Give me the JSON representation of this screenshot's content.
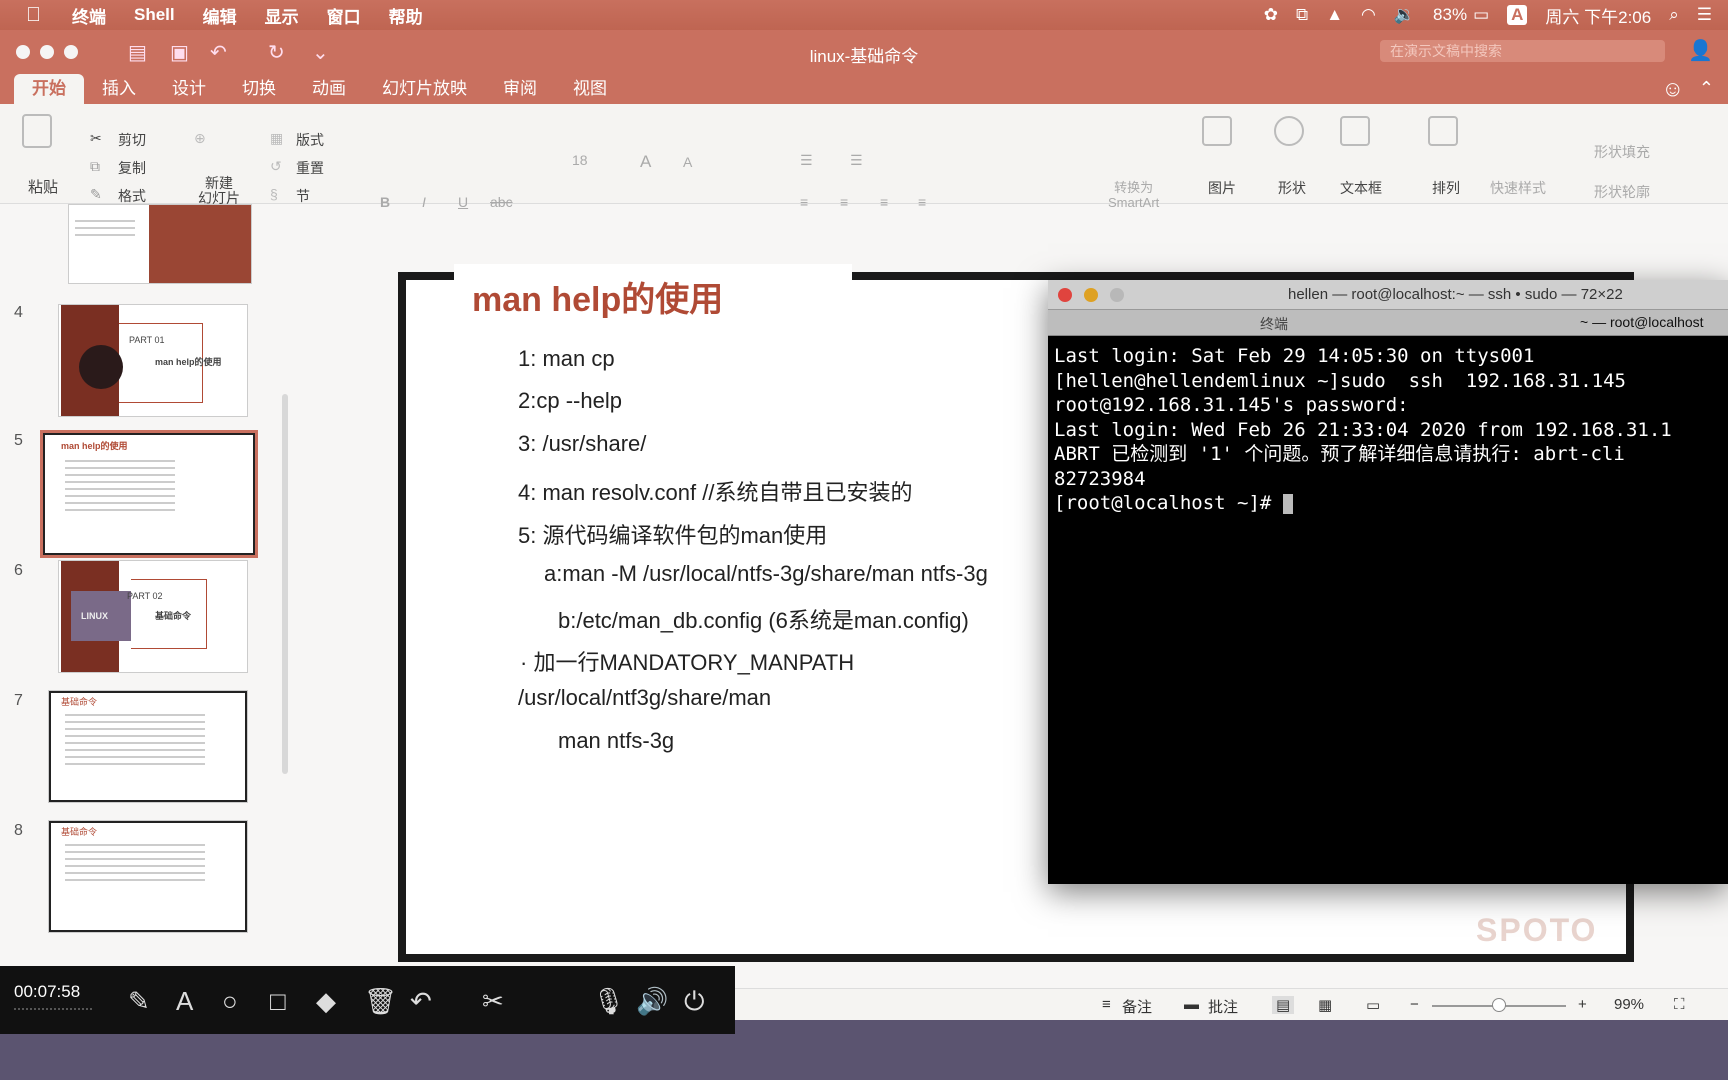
{
  "menubar": {
    "apple": "",
    "items": [
      "终端",
      "Shell",
      "编辑",
      "显示",
      "窗口",
      "帮助"
    ],
    "battery": "83%",
    "input_method": "A",
    "clock": "周六 下午2:06"
  },
  "window": {
    "title": "linux-基础命令",
    "search_placeholder": "在演示文稿中搜索"
  },
  "ribbon": {
    "tabs": [
      "开始",
      "插入",
      "设计",
      "切换",
      "动画",
      "幻灯片放映",
      "审阅",
      "视图"
    ],
    "paste": "粘贴",
    "cut": "剪切",
    "copy": "复制",
    "format": "格式",
    "new_slide": "新建\n幻灯片",
    "layout": "版式",
    "reset": "重置",
    "section": "节",
    "font_size": "18",
    "convert_smartart": "转换为\nSmartArt",
    "picture": "图片",
    "shape": "形状",
    "textbox": "文本框",
    "arrange": "排列",
    "quick_styles": "快速样式",
    "shape_fill": "形状填充",
    "shape_outline": "形状轮廓"
  },
  "thumbnails": [
    {
      "num": "4",
      "part": "PART 01",
      "title": "man  help的使用"
    },
    {
      "num": "5",
      "title": "man help的使用"
    },
    {
      "num": "6",
      "part": "PART 02",
      "title": "基础命令",
      "logo": "LINUX"
    },
    {
      "num": "7",
      "title": "基础命令"
    },
    {
      "num": "8",
      "title": "基础命令"
    }
  ],
  "slide": {
    "title": "man help的使用",
    "lines": [
      "1: man  cp",
      "2:cp  --help",
      "3: /usr/share/",
      "4: man  resolv.conf     //系统自带且已安装的",
      "5: 源代码编译软件包的man使用",
      "a:man  -M  /usr/local/ntfs-3g/share/man   ntfs-3g",
      "b:/etc/man_db.config (6系统是man.config)",
      "·      加一行MANDATORY_MANPATH",
      "/usr/local/ntf3g/share/man",
      "man  ntfs-3g"
    ],
    "watermark": "SPOTO"
  },
  "terminal": {
    "title": "hellen — root@localhost:~ — ssh • sudo — 72×22",
    "tab1": "终端",
    "tab2": "~ — root@localhost",
    "lines": [
      "Last login: Sat Feb 29 14:05:30 on ttys001",
      "[hellen@hellendemlinux ~]sudo  ssh  192.168.31.145",
      "root@192.168.31.145's password:",
      "Last login: Wed Feb 26 21:33:04 2020 from 192.168.31.1",
      "ABRT 已检测到 '1' 个问题。预了解详细信息请执行: abrt-cli",
      "82723984",
      "[root@localhost ~]# "
    ]
  },
  "statusbar": {
    "notes": "备注",
    "comments": "批注",
    "zoom": "99%"
  },
  "recorder": {
    "time": "00:07:58"
  }
}
